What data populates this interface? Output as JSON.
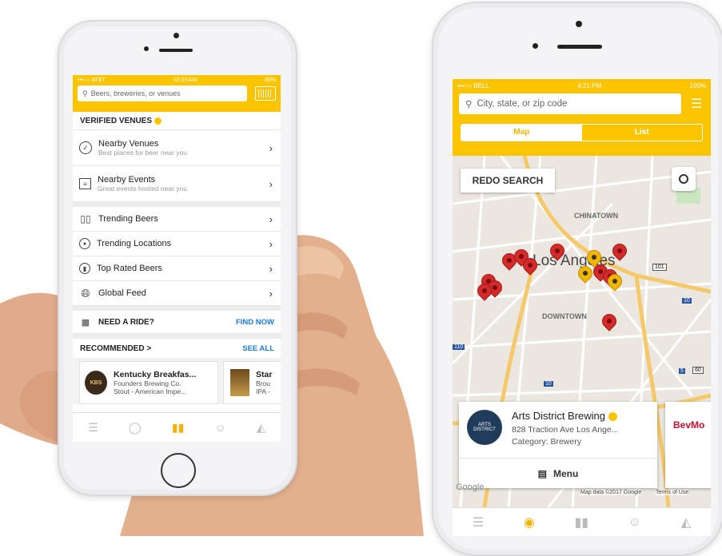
{
  "left_phone": {
    "status": {
      "carrier": "•••○○ AT&T",
      "time": "10:23 AM",
      "battery": "85%"
    },
    "search": {
      "placeholder": "Beers, breweries, or venues"
    },
    "verified_title": "VERIFIED VENUES",
    "rows_top": [
      {
        "title": "Nearby Venues",
        "subtitle": "Best places for beer near you",
        "icon": "check-circle-icon"
      },
      {
        "title": "Nearby Events",
        "subtitle": "Great events hosted near you",
        "icon": "calendar-icon"
      }
    ],
    "rows_mid": [
      {
        "title": "Trending Beers",
        "icon": "bottles-icon"
      },
      {
        "title": "Trending Locations",
        "icon": "location-pin-icon"
      },
      {
        "title": "Top Rated Beers",
        "icon": "beer-badge-icon"
      },
      {
        "title": "Global Feed",
        "icon": "globe-icon"
      }
    ],
    "ride": {
      "label": "NEED A RIDE?",
      "action": "FIND NOW"
    },
    "recommended": {
      "title": "RECOMMENDED >",
      "action": "SEE ALL"
    },
    "cards": [
      {
        "logo": "KBS",
        "name": "Kentucky Breakfas...",
        "brewery": "Founders Brewing Co.",
        "style": "Stout - American Impe..."
      },
      {
        "name": "Star",
        "brewery": "Brou",
        "style": "IPA -"
      }
    ]
  },
  "right_phone": {
    "status": {
      "carrier": "•••○○ BELL",
      "time": "4:21 PM",
      "battery": "100%"
    },
    "search": {
      "placeholder": "City, state, or zip code"
    },
    "tabs": {
      "map": "Map",
      "list": "List"
    },
    "redo": "REDO SEARCH",
    "map_labels": {
      "chinatown": "CHINATOWN",
      "los_angeles": "Los Angeles",
      "downtown": "DOWNTOWN",
      "hwy_101": "101",
      "hwy_110": "110",
      "hwy_10": "10",
      "hwy_10b": "10",
      "hwy_5": "5",
      "hwy_60": "60"
    },
    "card": {
      "logo": "ARTS DISTRICT",
      "name": "Arts District Brewing",
      "address": "828 Traction Ave Los Ange...",
      "category": "Category: Brewery",
      "menu": "Menu"
    },
    "next_card": "BevMo",
    "attribution": {
      "google": "Google",
      "map_data": "Map data ©2017 Google",
      "terms": "Terms of Use"
    },
    "colors": {
      "accent": "#fbc400",
      "pin_red": "#d42a2a",
      "pin_yellow": "#f2b600"
    }
  }
}
